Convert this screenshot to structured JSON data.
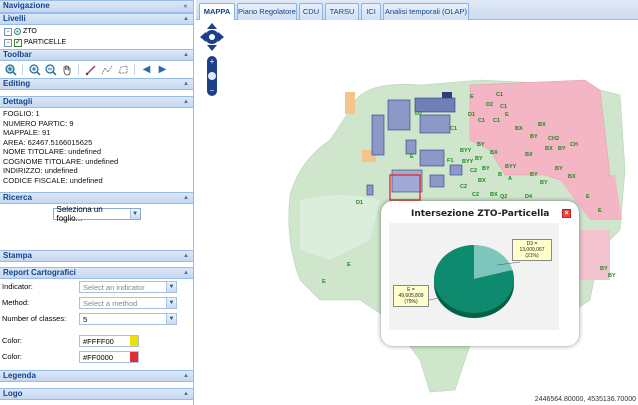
{
  "left_panel": {
    "navigation_title": "Navigazione",
    "layers": {
      "title": "Livelli",
      "items": [
        {
          "label": "ZTO"
        },
        {
          "label": "PARTICELLE"
        }
      ]
    },
    "toolbar": {
      "title": "Toolbar"
    },
    "editing": {
      "title": "Editing"
    },
    "details": {
      "title": "Dettagli",
      "lines": [
        "FOGLIO: 1",
        "NUMERO PARTIC: 9",
        "MAPPALE: 91",
        "AREA: 62467.5166015625",
        "NOME TITOLARE: undefined",
        "COGNOME TITOLARE: undefined",
        "INDIRIZZO: undefined",
        "CODICE FISCALE: undefined"
      ]
    },
    "search": {
      "title": "Ricerca",
      "select_value": "Seleziona un foglio..."
    },
    "print": {
      "title": "Stampa"
    },
    "report": {
      "title": "Report Cartografici",
      "indicator_label": "Indicator:",
      "indicator_placeholder": "Select an indicator",
      "method_label": "Method:",
      "method_placeholder": "Select a method",
      "classes_label": "Number of classes:",
      "classes_value": "5",
      "color1_label": "Color:",
      "color1_value": "#FFFF00",
      "color2_label": "Color:",
      "color2_value": "#FF0000"
    },
    "legend": {
      "title": "Legenda"
    },
    "logo": {
      "title": "Logo"
    }
  },
  "tabs": [
    {
      "label": "MAPPA",
      "active": true
    },
    {
      "label": "Piano Regolatore",
      "active": false
    },
    {
      "label": "CDU",
      "active": false
    },
    {
      "label": "TARSU",
      "active": false
    },
    {
      "label": "ICI",
      "active": false
    },
    {
      "label": "Analisi temporali (OLAP)",
      "active": false
    }
  ],
  "map": {
    "coordinates": "2446564.80000, 4535136.70000",
    "zone_labels": [
      "D1",
      "D2",
      "D2",
      "C1",
      "C1",
      "C1",
      "D1",
      "E",
      "F1",
      "BX",
      "BY",
      "BYY",
      "C2",
      "BX",
      "BY",
      "A",
      "BX",
      "BY",
      "BX",
      "CH",
      "BX",
      "BY",
      "D2",
      "E",
      "E",
      "E",
      "E",
      "F1",
      "C2",
      "Q2",
      "D4",
      "BY",
      "BY"
    ]
  },
  "popup": {
    "title": "Intersezione ZTO-Particella",
    "chart_data": {
      "type": "pie",
      "title": "Intersezione ZTO-Particella",
      "slices": [
        {
          "label": "D3 =",
          "value": 13009.067,
          "value_text": "13,009,067",
          "percent_text": "(21%)",
          "color": "#7dc6bc"
        },
        {
          "label": "E =",
          "value": 49605.809,
          "value_text": "49,605,809",
          "percent_text": "(79%)",
          "color": "#0e8a6e"
        }
      ]
    }
  },
  "colors": {
    "header_bg": "#c4d7f0",
    "header_text": "#15428b",
    "map_green": "#cfe6cd",
    "map_pink": "#f4b5c4",
    "parcel_blue": "#8c98c8"
  }
}
